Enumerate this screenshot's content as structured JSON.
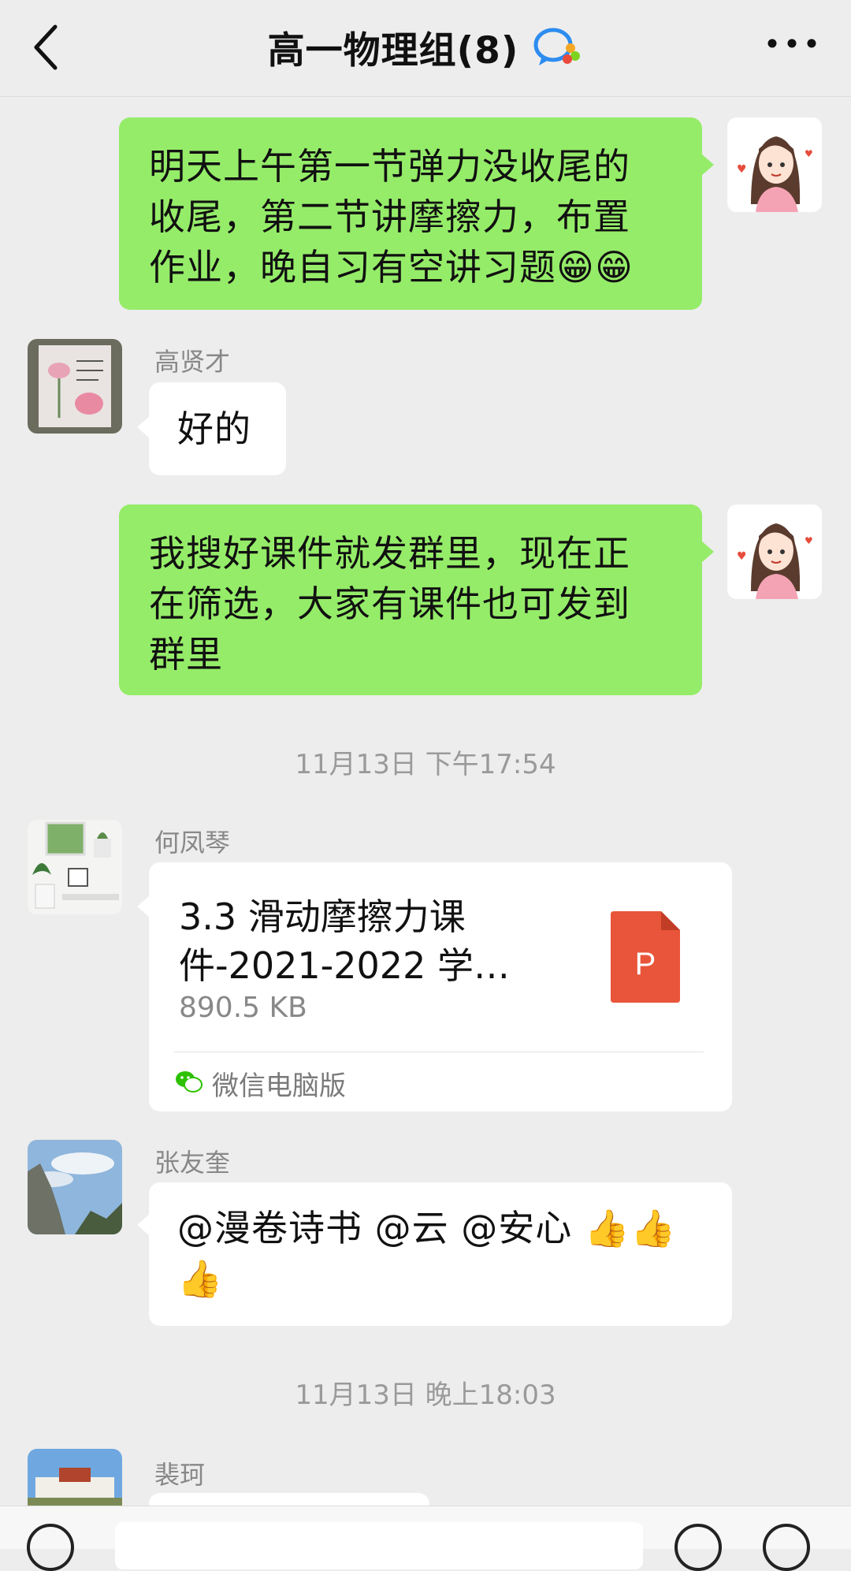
{
  "header": {
    "title": "高一物理组(8)",
    "back_icon": "chevron-left-icon",
    "group_icon": "group-chat-icon",
    "more_icon": "more-dots-icon"
  },
  "messages": [
    {
      "sender": "me",
      "type": "text",
      "lines": [
        "明天上午第一节弹力没收尾的",
        "收尾，第二节讲摩擦力，布置",
        "作业，晚自习有空讲习题😁😁"
      ]
    },
    {
      "sender": "高贤才",
      "type": "text",
      "lines": [
        "好的"
      ]
    },
    {
      "sender": "me",
      "type": "text",
      "lines": [
        "我搜好课件就发群里，现在正",
        "在筛选，大家有课件也可发到",
        "群里"
      ]
    },
    {
      "type": "timestamp",
      "text": "11月13日 下午17:54"
    },
    {
      "sender": "何凤琴",
      "type": "file",
      "file_name_lines": [
        "3.3 滑动摩擦力课",
        "件-2021-2022 学…"
      ],
      "file_size": "890.5 KB",
      "file_type_letter": "P",
      "source": "微信电脑版"
    },
    {
      "sender": "张友奎",
      "type": "text",
      "lines": [
        "@漫卷诗书  @云  @安心  👍👍",
        "👍"
      ]
    },
    {
      "type": "timestamp",
      "text": "11月13日 晚上18:03"
    },
    {
      "sender": "裴珂",
      "type": "text",
      "lines": [
        ""
      ]
    }
  ],
  "colors": {
    "background": "#ededed",
    "my_bubble": "#95ec69",
    "other_bubble": "#ffffff",
    "ppt_icon": "#e9553a"
  }
}
